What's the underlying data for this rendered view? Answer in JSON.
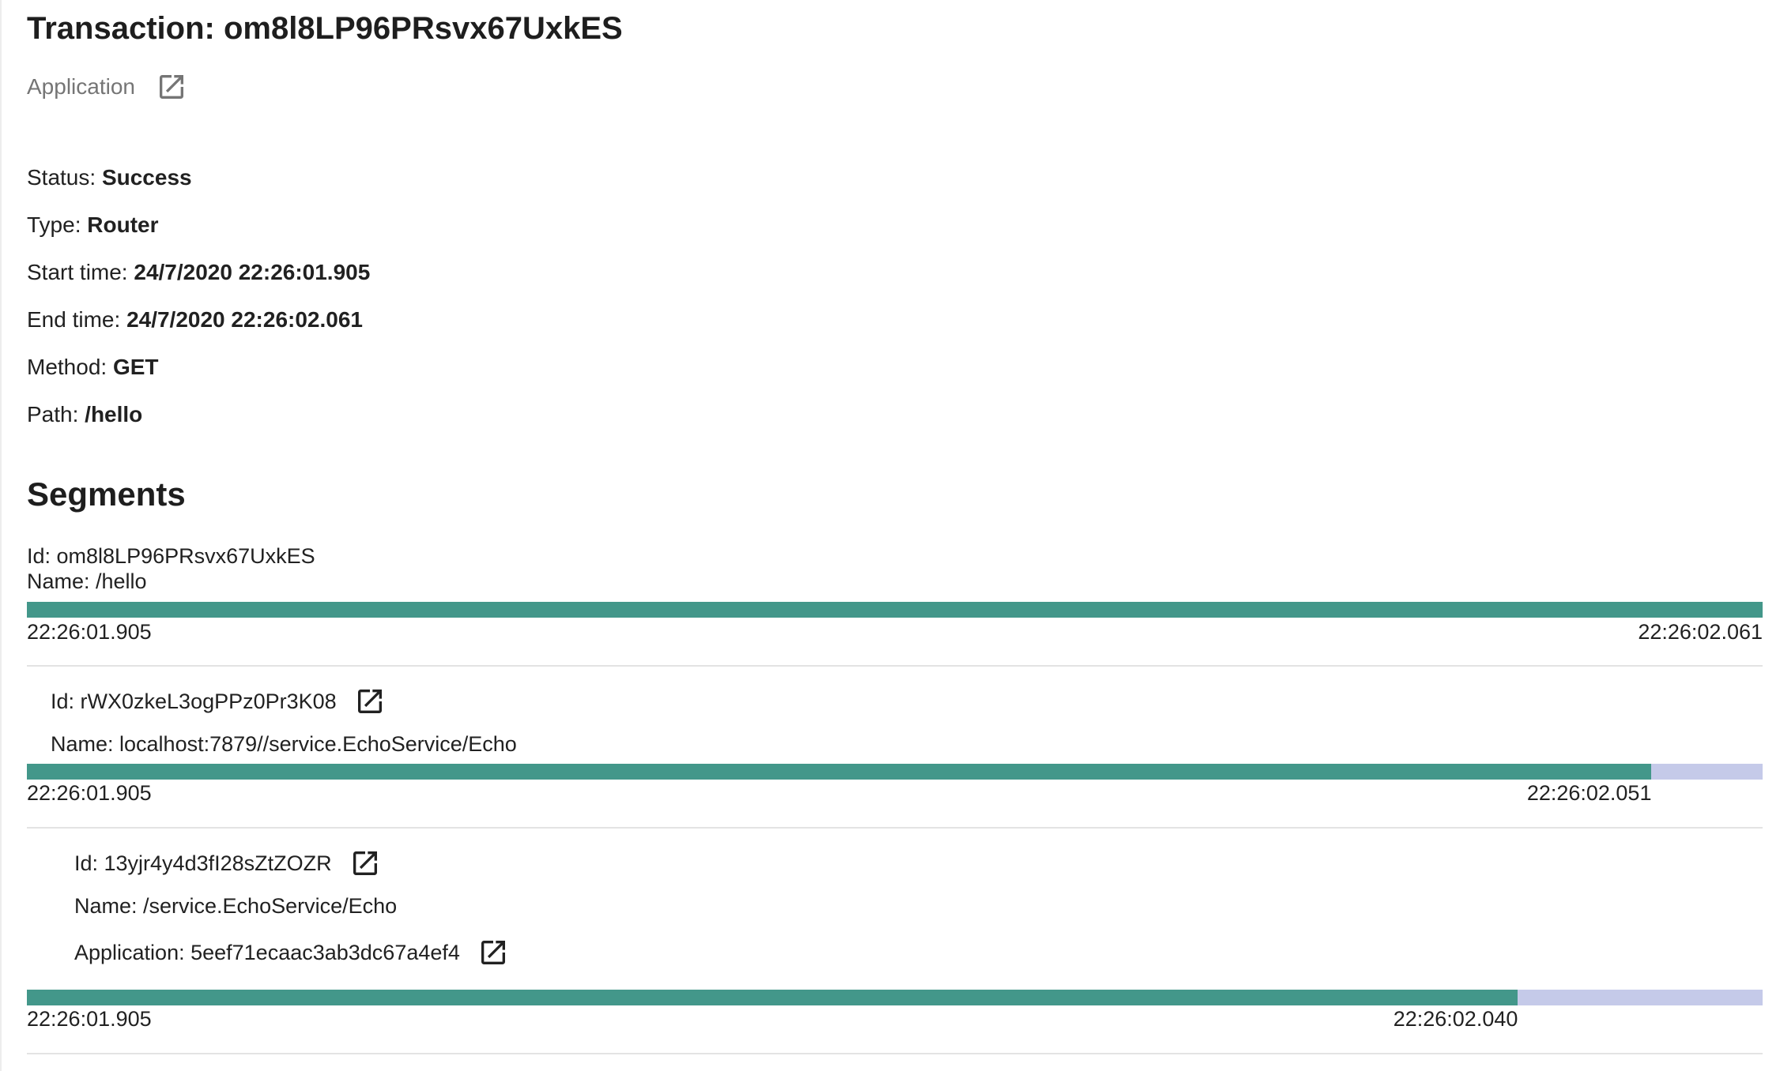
{
  "header": {
    "title": "Transaction: om8l8LP96PRsvx67UxkES",
    "app_link_label": "Application"
  },
  "info": {
    "status_label": "Status:",
    "status_value": "Success",
    "type_label": "Type:",
    "type_value": "Router",
    "start_label": "Start time:",
    "start_value": "24/7/2020 22:26:01.905",
    "end_label": "End time:",
    "end_value": "24/7/2020 22:26:02.061",
    "method_label": "Method:",
    "method_value": "GET",
    "path_label": "Path:",
    "path_value": "/hello"
  },
  "segments_heading": "Segments",
  "segments": [
    {
      "id_text": "Id: om8l8LP96PRsvx67UxkES",
      "name_text": "Name: /hello",
      "start": "22:26:01.905",
      "end": "22:26:02.061",
      "fill_fraction": 1.0
    },
    {
      "id_text": "Id: rWX0zkeL3ogPPz0Pr3K08",
      "name_text": "Name: localhost:7879//service.EchoService/Echo",
      "start": "22:26:01.905",
      "end": "22:26:02.051",
      "fill_fraction": 0.936
    },
    {
      "id_text": "Id: 13yjr4y4d3fI28sZtZOZR",
      "name_text": "Name: /service.EchoService/Echo",
      "application_text": "Application: 5eef71ecaac3ab3dc67a4ef4",
      "start": "22:26:01.905",
      "end": "22:26:02.040",
      "fill_fraction": 0.859
    }
  ],
  "colors": {
    "bar_fill": "#43978a",
    "bar_track": "#c5cae9"
  },
  "icons": {
    "external_link": "open-in-new-icon"
  }
}
